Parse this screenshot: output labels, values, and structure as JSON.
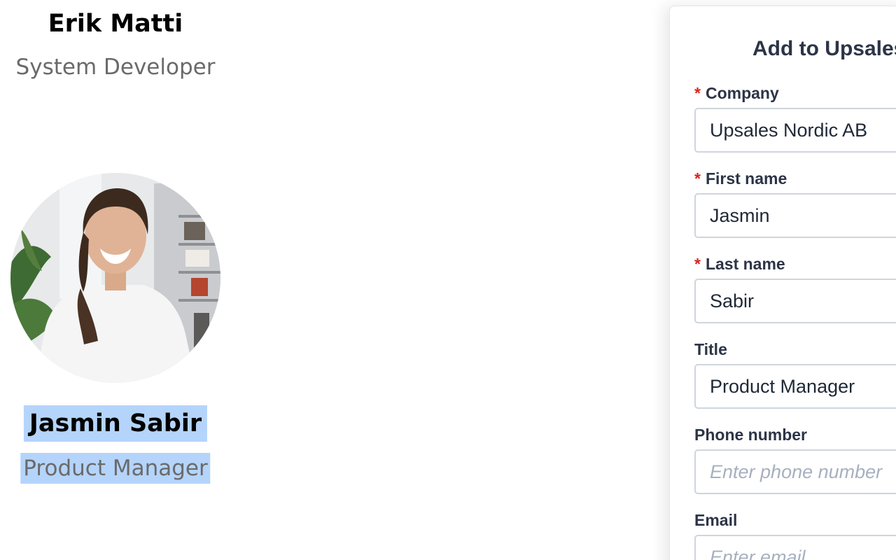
{
  "team": [
    {
      "name": "Erik Matti",
      "title": "System Developer"
    },
    {
      "name": "Jasmin Sabir",
      "title": "Product Manager"
    }
  ],
  "panel": {
    "title": "Add to Upsales",
    "fields": {
      "company": {
        "label": "Company",
        "required": true,
        "value": "Upsales Nordic AB",
        "placeholder": ""
      },
      "first_name": {
        "label": "First name",
        "required": true,
        "value": "Jasmin",
        "placeholder": ""
      },
      "last_name": {
        "label": "Last name",
        "required": true,
        "value": "Sabir",
        "placeholder": ""
      },
      "title": {
        "label": "Title",
        "required": false,
        "value": "Product Manager",
        "placeholder": ""
      },
      "phone": {
        "label": "Phone number",
        "required": false,
        "value": "",
        "placeholder": "Enter phone number"
      },
      "email": {
        "label": "Email",
        "required": false,
        "value": "",
        "placeholder": "Enter email"
      }
    },
    "required_marker": "*"
  },
  "colors": {
    "selection": "#b4d4fb",
    "required": "#e0201e",
    "label": "#2c3446",
    "input_border": "#cfd5dc"
  }
}
